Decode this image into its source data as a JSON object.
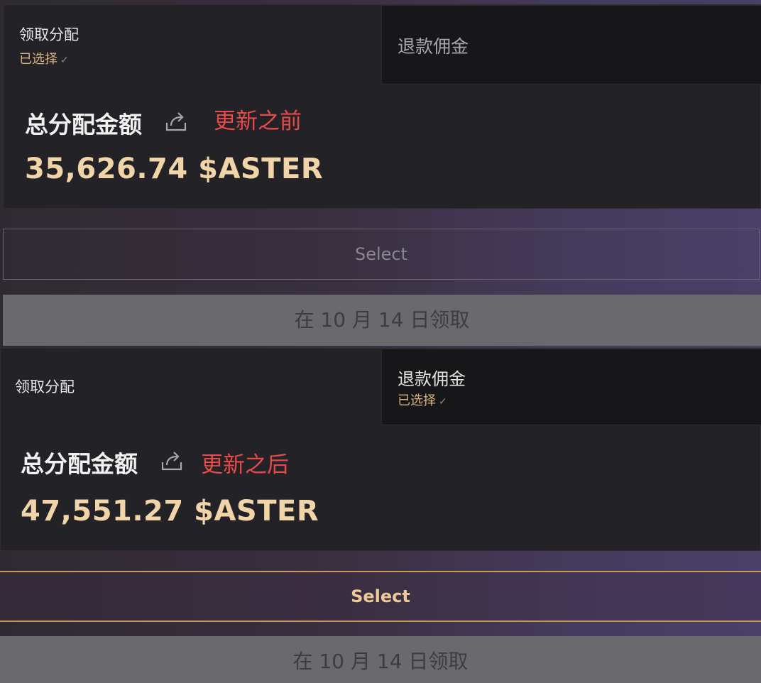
{
  "before": {
    "tabs": {
      "claim_label": "领取分配",
      "claim_selected": "已选择",
      "refund_label": "退款佣金"
    },
    "total_label": "总分配金额",
    "note": "更新之前",
    "amount": "35,626.74 $ASTER",
    "select_label": "Select",
    "claim_button": "在 10 月 14 日领取"
  },
  "after": {
    "tabs": {
      "claim_label": "领取分配",
      "refund_label": "退款佣金",
      "refund_selected": "已选择"
    },
    "total_label": "总分配金额",
    "note": "更新之后",
    "amount": "47,551.27 $ASTER",
    "select_label": "Select",
    "claim_button": "在 10 月 14 日领取"
  },
  "icons": {
    "check": "check-icon",
    "share": "share-icon"
  },
  "colors": {
    "accent_gold": "#f1d5a8",
    "selected_text": "#d7b384",
    "note_red": "#e74a4a",
    "card_bg": "#232226"
  }
}
